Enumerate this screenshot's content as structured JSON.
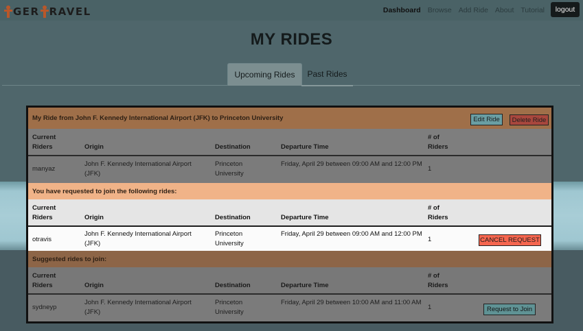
{
  "navbar": {
    "brand_left": "T",
    "brand_mid": "GER",
    "brand_right": "RAVEL",
    "links": [
      "Dashboard",
      "Browse",
      "Add Ride",
      "About",
      "Tutorial"
    ],
    "logout": "logout"
  },
  "page": {
    "title": "MY RIDES",
    "tabs": [
      "Upcoming Rides",
      "Past Rides"
    ]
  },
  "my_ride": {
    "header": "My Ride from John F. Kennedy International Airport (JFK) to Princeton University",
    "edit_label": "Edit Ride",
    "delete_label": "Delete Ride"
  },
  "columns": {
    "riders_line1": "Current",
    "riders_line2": "Riders",
    "origin": "Origin",
    "destination": "Destination",
    "time": "Departure Time",
    "num_line1": "# of",
    "num_line2": "Riders"
  },
  "rows": {
    "my": {
      "rider": "manyaz",
      "origin": "John F. Kennedy International Airport (JFK)",
      "destination": "Princeton University",
      "time": "Friday, April 29 between 09:00 AM and 12:00 PM",
      "count": "1"
    },
    "requested": {
      "rider": "otravis",
      "origin": "John F. Kennedy International Airport (JFK)",
      "destination": "Princeton University",
      "time": "Friday, April 29 between 09:00 AM and 12:00 PM",
      "count": "1",
      "action": "CANCEL REQUEST"
    },
    "suggested": {
      "rider": "sydneyp",
      "origin": "John F. Kennedy International Airport (JFK)",
      "destination": "Princeton University",
      "time": "Friday, April 29 between 10:00 AM and 11:00 AM",
      "count": "1",
      "action": "Request to Join"
    }
  },
  "sections": {
    "requested": "You have requested to join the following rides:",
    "suggested": "Suggested rides to join:"
  }
}
